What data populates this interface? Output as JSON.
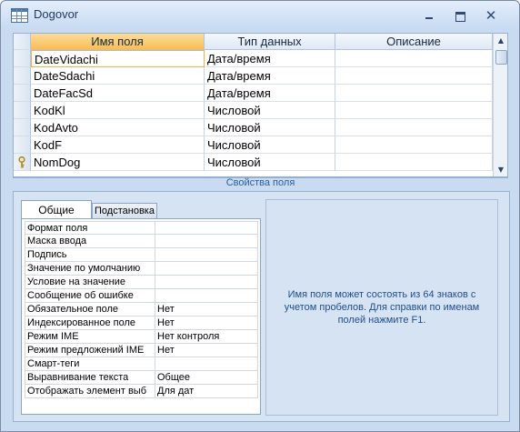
{
  "window": {
    "title": "Dogovor",
    "icons": [
      "table-icon",
      "minimize-icon",
      "maximize-icon",
      "close-icon"
    ]
  },
  "grid": {
    "columns": [
      "Имя поля",
      "Тип данных",
      "Описание"
    ],
    "selected_column": 0,
    "rows": [
      {
        "name": "DateVidachi",
        "type": "Дата/время",
        "desc": "",
        "key": false,
        "selected": true
      },
      {
        "name": "DateSdachi",
        "type": "Дата/время",
        "desc": "",
        "key": false
      },
      {
        "name": "DateFacSd",
        "type": "Дата/время",
        "desc": "",
        "key": false
      },
      {
        "name": "KodKl",
        "type": "Числовой",
        "desc": "",
        "key": false
      },
      {
        "name": "KodAvto",
        "type": "Числовой",
        "desc": "",
        "key": false
      },
      {
        "name": "KodF",
        "type": "Числовой",
        "desc": "",
        "key": false
      },
      {
        "name": "NomDog",
        "type": "Числовой",
        "desc": "",
        "key": true
      }
    ]
  },
  "properties": {
    "section_label": "Свойства поля",
    "tabs": [
      "Общие",
      "Подстановка"
    ],
    "active_tab": 0,
    "items": [
      {
        "name": "Формат поля",
        "value": ""
      },
      {
        "name": "Маска ввода",
        "value": ""
      },
      {
        "name": "Подпись",
        "value": ""
      },
      {
        "name": "Значение по умолчанию",
        "value": ""
      },
      {
        "name": "Условие на значение",
        "value": ""
      },
      {
        "name": "Сообщение об ошибке",
        "value": ""
      },
      {
        "name": "Обязательное поле",
        "value": "Нет"
      },
      {
        "name": "Индексированное поле",
        "value": "Нет"
      },
      {
        "name": "Режим IME",
        "value": "Нет контроля"
      },
      {
        "name": "Режим предложений IME",
        "value": "Нет"
      },
      {
        "name": "Смарт-теги",
        "value": ""
      },
      {
        "name": "Выравнивание текста",
        "value": "Общее"
      },
      {
        "name": "Отображать элемент выб",
        "value": "Для дат"
      }
    ],
    "help_text": "Имя поля может состоять из 64 знаков с учетом пробелов.  Для справки по именам полей нажмите F1."
  }
}
